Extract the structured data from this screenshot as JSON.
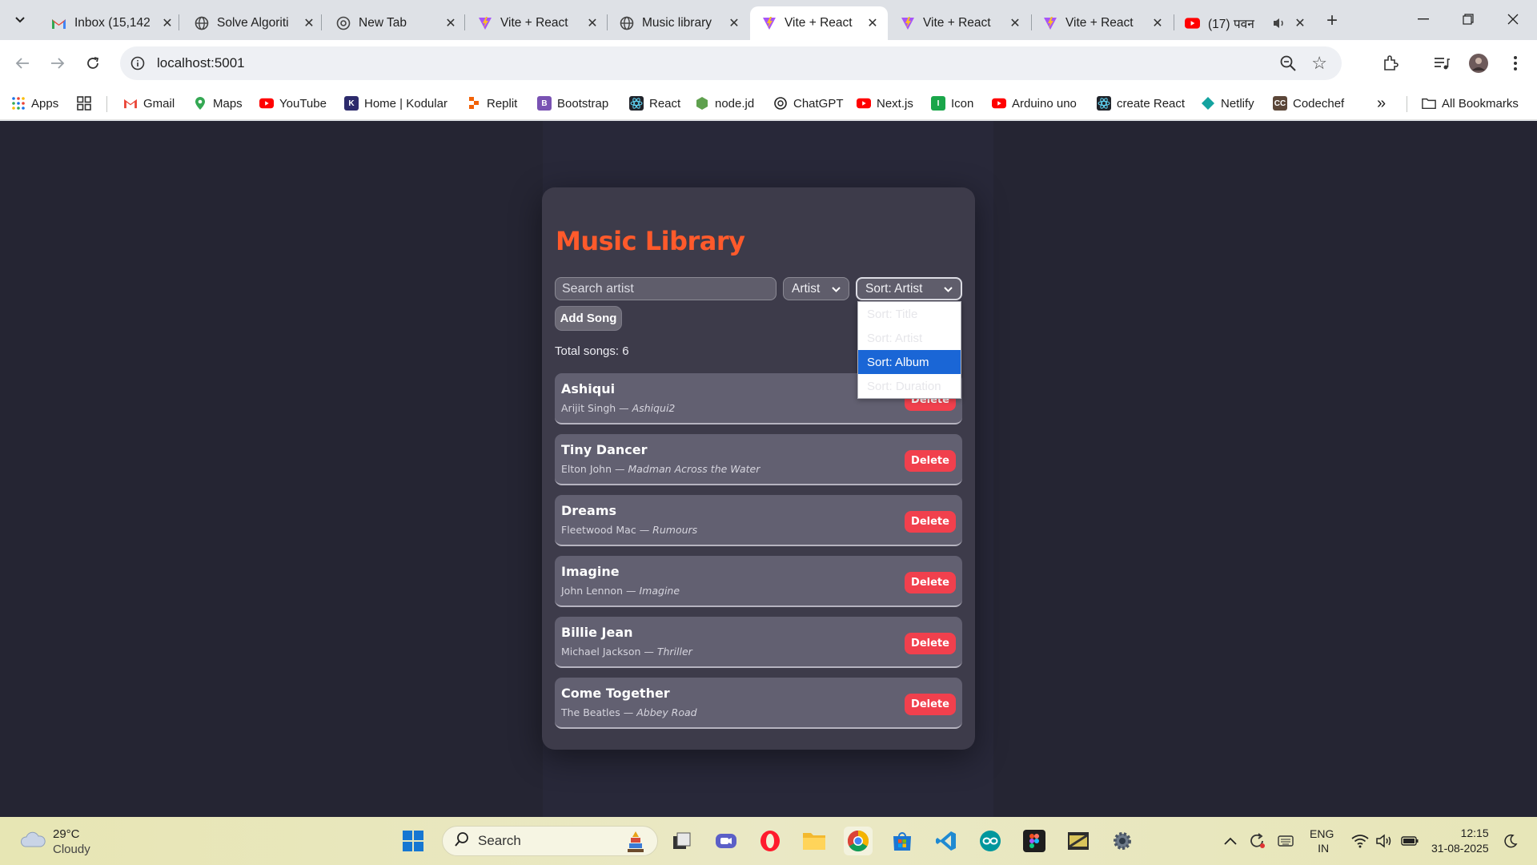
{
  "browser": {
    "tabs": [
      {
        "label": "Inbox (15,142",
        "favicon": "gmail-icon"
      },
      {
        "label": "Solve Algoriti",
        "favicon": "globe-icon"
      },
      {
        "label": "New Tab",
        "favicon": "chrome-icon"
      },
      {
        "label": "Vite + React",
        "favicon": "vite-icon"
      },
      {
        "label": "Music library",
        "favicon": "globe-icon"
      },
      {
        "label": "Vite + React",
        "favicon": "vite-icon",
        "active": true
      },
      {
        "label": "Vite + React",
        "favicon": "vite-icon"
      },
      {
        "label": "Vite + React",
        "favicon": "vite-icon"
      },
      {
        "label": "(17) पवन",
        "favicon": "youtube-icon",
        "audio": true
      }
    ],
    "url": "localhost:5001",
    "bookmarks": [
      {
        "label": "Apps"
      },
      {
        "label": "Gmail"
      },
      {
        "label": "Maps"
      },
      {
        "label": "YouTube"
      },
      {
        "label": "Home | Kodular"
      },
      {
        "label": "Replit"
      },
      {
        "label": "Bootstrap"
      },
      {
        "label": "React"
      },
      {
        "label": "node.jd"
      },
      {
        "label": "ChatGPT"
      },
      {
        "label": "Next.js"
      },
      {
        "label": "Icon"
      },
      {
        "label": "Arduino uno"
      },
      {
        "label": "create React"
      },
      {
        "label": "Netlify"
      },
      {
        "label": "Codechef"
      }
    ],
    "bookmarks_overflow": "»",
    "all_bookmarks": "All Bookmarks"
  },
  "app": {
    "title": "Music Library",
    "search_placeholder": "Search artist",
    "filter_value": "Artist",
    "sort_value": "Sort: Artist",
    "add_button": "Add Song",
    "total": "Total songs: 6",
    "delete_label": "Delete",
    "sort_options": [
      {
        "label": "Sort: Title"
      },
      {
        "label": "Sort: Artist"
      },
      {
        "label": "Sort: Album",
        "highlighted": true
      },
      {
        "label": "Sort: Duration"
      }
    ],
    "songs": [
      {
        "title": "Ashiqui",
        "artist": "Arijit Singh",
        "album": "Ashiqui2"
      },
      {
        "title": "Tiny Dancer",
        "artist": "Elton John",
        "album": "Madman Across the Water"
      },
      {
        "title": "Dreams",
        "artist": "Fleetwood Mac",
        "album": "Rumours"
      },
      {
        "title": "Imagine",
        "artist": "John Lennon",
        "album": "Imagine"
      },
      {
        "title": "Billie Jean",
        "artist": "Michael Jackson",
        "album": "Thriller"
      },
      {
        "title": "Come Together",
        "artist": "The Beatles",
        "album": "Abbey Road"
      }
    ],
    "separator": "—",
    "colors": {
      "title": "#ff5a2b",
      "delete": "#f1404d",
      "highlight": "#1a66d6"
    }
  },
  "taskbar": {
    "weather_temp": "29°C",
    "weather_desc": "Cloudy",
    "search_label": "Search",
    "lang_top": "ENG",
    "lang_bottom": "IN",
    "time": "12:15",
    "date": "31-08-2025"
  }
}
